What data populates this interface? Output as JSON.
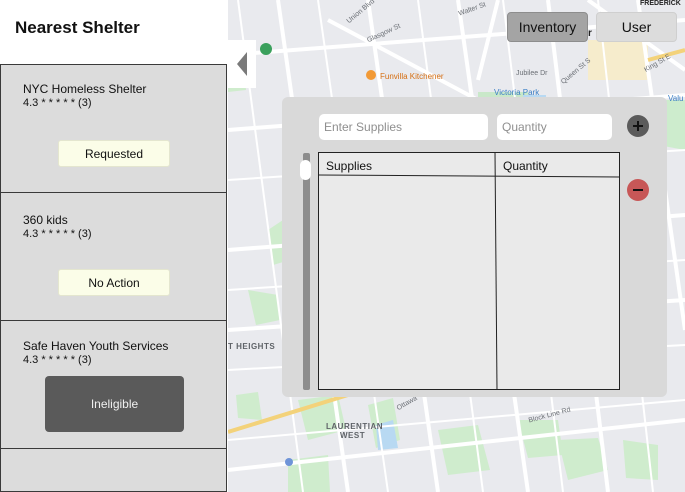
{
  "sidebar": {
    "title": "Nearest Shelter",
    "shelters": [
      {
        "name": "NYC Homeless Shelter",
        "rating": "4.3 * * * * * (3)",
        "status": "Requested"
      },
      {
        "name": "360 kids",
        "rating": "4.3 * * * * * (3)",
        "status": "No Action"
      },
      {
        "name": "Safe Haven Youth Services",
        "rating": "4.3 * * * * * (3)",
        "status": "Ineligible"
      }
    ]
  },
  "nav": {
    "inventory": "Inventory",
    "user": "User"
  },
  "inventory": {
    "supplies_placeholder": "Enter Supplies",
    "quantity_placeholder": "Quantity",
    "columns": [
      "Supplies",
      "Quantity"
    ],
    "rows": []
  },
  "map": {
    "labels": {
      "union_blvd": "Union Blvd",
      "glasgow_st": "Glasgow St",
      "walter_st": "Walter St",
      "frederick": "FREDERICK",
      "funvilla": "Funvilla Kitchener",
      "victoria_park": "Victoria Park",
      "jubilee": "Jubilee Dr",
      "queen_st": "Queen St S",
      "king_st": "King St E",
      "valu": "Valu",
      "heights": "T HEIGHTS",
      "laurentian": "LAURENTIAN",
      "west": "WEST",
      "block_line": "Block Line Rd",
      "ottawa": "Ottawa",
      "r_partial": "r"
    }
  }
}
